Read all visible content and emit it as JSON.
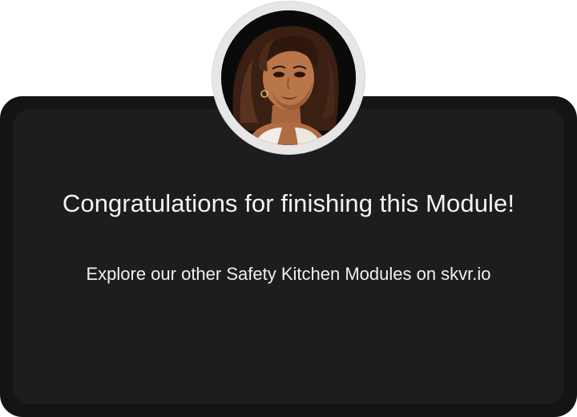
{
  "completion_card": {
    "title": "Congratulations for finishing this Module!",
    "subtitle": "Explore our other Safety Kitchen Modules on skvr.io"
  },
  "avatar": {
    "icon": "instructor-avatar",
    "description": "illustrated portrait"
  },
  "colors": {
    "page_background": "#ffffff",
    "card_outer": "#141414",
    "card_inner": "#1d1d1d",
    "text": "#f4f4f4",
    "avatar_ring": "#e6e6e6"
  }
}
